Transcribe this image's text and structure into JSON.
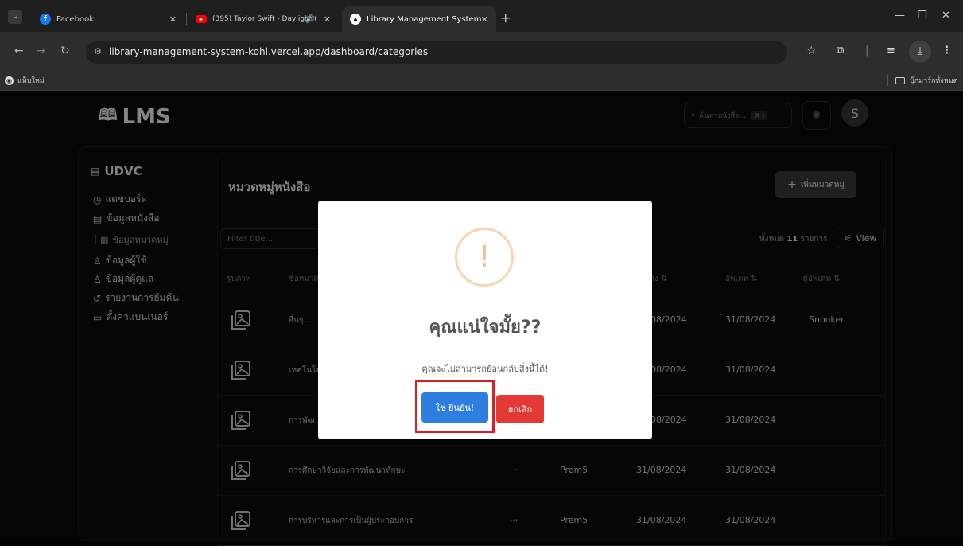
{
  "browser": {
    "tabs": [
      {
        "title": "Facebook",
        "close": "✕"
      },
      {
        "title": "(395) Taylor Swift - Daylight (",
        "audio": "🔊",
        "close": "✕"
      },
      {
        "title": "Library Management System",
        "close": "✕"
      }
    ],
    "new_tab": "+",
    "url": "library-management-system-kohl.vercel.app/dashboard/categories",
    "bookmark_left": "แท็บใหม่",
    "bookmark_right": "บุ๊กมาร์กทั้งหมด"
  },
  "app": {
    "logo": "LMS",
    "search_placeholder": "ค้นหาหนังสือ...",
    "search_shortcut": "⌘ J",
    "avatar_initial": "S"
  },
  "sidebar": {
    "title": "UDVC",
    "items": [
      {
        "icon": "◷",
        "label": "แดชบอร์ด"
      },
      {
        "icon": "▤",
        "label": "ข้อมูลหนังสือ"
      },
      {
        "icon": "▦",
        "label": "ข้อมูลหมวดหมู่"
      },
      {
        "icon": "♙",
        "label": "ข้อมูลผู้ใช้"
      },
      {
        "icon": "♙",
        "label": "ข้อมูลผู้ดูแล"
      },
      {
        "icon": "↺",
        "label": "รายงานการยืมคืน"
      },
      {
        "icon": "▭",
        "label": "ตั้งค่าแบนเนอร์"
      }
    ]
  },
  "main": {
    "title": "หมวดหมู่หนังสือ",
    "add_button": "เพิ่มหมวดหมู่",
    "filter_placeholder": "Filter title...",
    "total_prefix": "ทั้งหมด",
    "total_count": "11",
    "total_suffix": "รายการ",
    "view_button": "View",
    "columns": [
      "รูปภาพ",
      "ชื่อหมวด",
      "สร้าง ⇅",
      "อัพเดท ⇅",
      "ผู้อัพเดท ⇅"
    ],
    "rows": [
      {
        "name": "อื่นๆ...",
        "menu": "",
        "creator": "",
        "created": "08/2024",
        "updated": "31/08/2024",
        "updater": "Snooker"
      },
      {
        "name": "เทคโนโล",
        "menu": "",
        "creator": "",
        "created": "08/2024",
        "updated": "31/08/2024",
        "updater": ""
      },
      {
        "name": "การพัฒ",
        "menu": "",
        "creator": "",
        "created": "08/2024",
        "updated": "31/08/2024",
        "updater": ""
      },
      {
        "name": "การศึกษาวิจัยและการพัฒนาทักษะ",
        "menu": "···",
        "creator": "Prem5",
        "created": "31/08/2024",
        "updated": "31/08/2024",
        "updater": ""
      },
      {
        "name": "การบริหารและการเป็นผู้ประกอบการ",
        "menu": "···",
        "creator": "Prem5",
        "created": "31/08/2024",
        "updated": "31/08/2024",
        "updater": ""
      }
    ]
  },
  "modal": {
    "icon": "!",
    "title": "คุณแน่ใจมั้ย??",
    "text": "คุณจะไม่สามารถย้อนกลับสิ่งนี้ได้!",
    "confirm": "ใช่ ยืนยัน!",
    "cancel": "ยกเลิก"
  },
  "colors": {
    "confirm": "#2e7ee0",
    "cancel": "#e53935",
    "highlight": "#e11b22",
    "warning": "#f3bd8c"
  }
}
